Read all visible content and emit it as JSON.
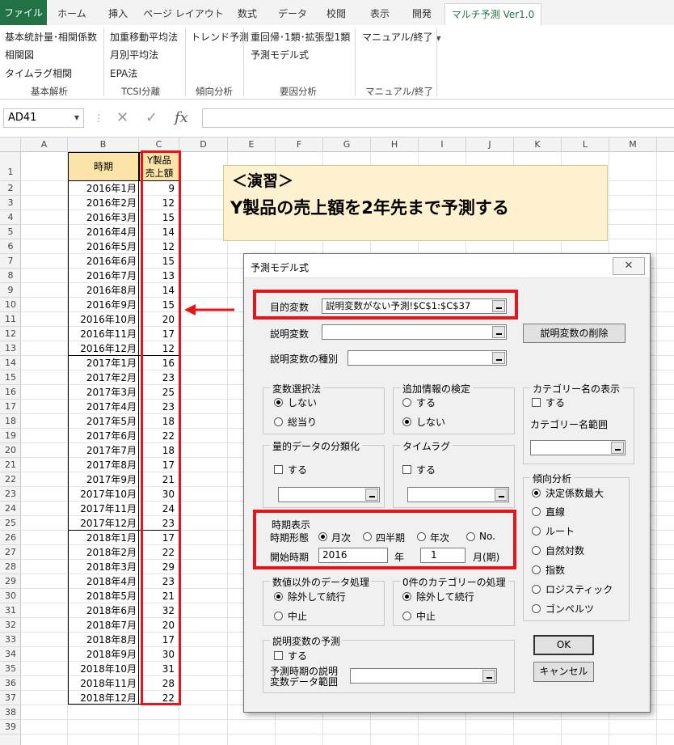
{
  "ribbon": {
    "tabs": [
      "ファイル",
      "ホーム",
      "挿入",
      "ページ レイアウト",
      "数式",
      "データ",
      "校閲",
      "表示",
      "開発",
      "マルチ予測 Ver1.0"
    ],
    "commands": {
      "basic_stats": "基本統計量･相関係数",
      "correlation_chart": "相関図",
      "timelag_corr": "タイムラグ相関",
      "weighted_ma": "加重移動平均法",
      "monthly_avg": "月別平均法",
      "epa": "EPA法",
      "trend_forecast": "トレンド予測",
      "regression": "重回帰･1類･拡張型1類",
      "forecast_model": "予測モデル式",
      "manual_exit": "マニュアル/終了"
    },
    "groups": {
      "basic": "基本解析",
      "tcsi": "TCSI分離",
      "trend": "傾向分析",
      "factor": "要因分析",
      "manual": "マニュアル/終了"
    }
  },
  "formula_bar": {
    "name_box": "AD41",
    "cancel": "✕",
    "enter": "✓",
    "fx": "fx",
    "value": ""
  },
  "columns": [
    "A",
    "B",
    "C",
    "D",
    "E",
    "F",
    "G",
    "H",
    "I",
    "J",
    "K",
    "L",
    "M"
  ],
  "rows": [
    "1",
    "2",
    "3",
    "4",
    "5",
    "6",
    "7",
    "8",
    "9",
    "10",
    "11",
    "12",
    "13",
    "14",
    "15",
    "16",
    "17",
    "18",
    "19",
    "20",
    "21",
    "22",
    "23",
    "24",
    "25",
    "26",
    "27",
    "28",
    "29",
    "30",
    "31",
    "32",
    "33",
    "34",
    "35",
    "36",
    "37",
    "38",
    "39"
  ],
  "table": {
    "header_period": "時期",
    "header_sales_1": "Y製品",
    "header_sales_2": "売上額",
    "periods": [
      "2016年1月",
      "2016年2月",
      "2016年3月",
      "2016年4月",
      "2016年5月",
      "2016年6月",
      "2016年7月",
      "2016年8月",
      "2016年9月",
      "2016年10月",
      "2016年11月",
      "2016年12月",
      "2017年1月",
      "2017年2月",
      "2017年3月",
      "2017年4月",
      "2017年5月",
      "2017年6月",
      "2017年7月",
      "2017年8月",
      "2017年9月",
      "2017年10月",
      "2017年11月",
      "2017年12月",
      "2018年1月",
      "2018年2月",
      "2018年3月",
      "2018年4月",
      "2018年5月",
      "2018年6月",
      "2018年7月",
      "2018年8月",
      "2018年9月",
      "2018年10月",
      "2018年11月",
      "2018年12月"
    ],
    "sales": [
      "9",
      "12",
      "15",
      "14",
      "12",
      "15",
      "13",
      "14",
      "15",
      "20",
      "17",
      "12",
      "16",
      "23",
      "25",
      "23",
      "18",
      "22",
      "18",
      "17",
      "21",
      "30",
      "24",
      "23",
      "17",
      "22",
      "29",
      "23",
      "21",
      "32",
      "20",
      "17",
      "30",
      "31",
      "28",
      "22"
    ]
  },
  "note": {
    "line1": "＜演習＞",
    "line2": "Y製品の売上額を2年先まで予測する"
  },
  "dialog": {
    "title": "予測モデル式",
    "close": "✕",
    "target_var_label": "目的変数",
    "target_var_value": "説明変数がない予測!$C$1:$C$37",
    "expl_var_label": "説明変数",
    "expl_var_value": "",
    "delete_expl_button": "説明変数の削除",
    "expl_type_label": "説明変数の種別",
    "expl_type_value": "",
    "var_select": {
      "caption": "変数選択法",
      "opt1": "しない",
      "opt2": "総当り"
    },
    "additional_test": {
      "caption": "追加情報の検定",
      "opt1": "する",
      "opt2": "しない"
    },
    "category_name": {
      "caption": "カテゴリー名の表示",
      "check": "する",
      "range_label": "カテゴリー名範囲",
      "range_value": ""
    },
    "quant_class": {
      "caption": "量的データの分類化",
      "check": "する",
      "value": ""
    },
    "timelag": {
      "caption": "タイムラグ",
      "check": "する",
      "value": ""
    },
    "trend": {
      "caption": "傾向分析",
      "options": [
        "決定係数最大",
        "直線",
        "ルート",
        "自然対数",
        "指数",
        "ロジスティック",
        "ゴンペルツ"
      ]
    },
    "period": {
      "caption": "時期表示",
      "form_label": "時期形態",
      "opt_monthly": "月次",
      "opt_quarter": "四半期",
      "opt_yearly": "年次",
      "opt_no": "No.",
      "start_label": "開始時期",
      "start_year": "2016",
      "year_unit": "年",
      "start_month": "1",
      "month_unit": "月(期)"
    },
    "non_numeric": {
      "caption": "数値以外のデータ処理",
      "opt1": "除外して続行",
      "opt2": "中止"
    },
    "zero_category": {
      "caption": "0件のカテゴリーの処理",
      "opt1": "除外して続行",
      "opt2": "中止"
    },
    "expl_forecast": {
      "caption": "説明変数の予測",
      "check": "する",
      "range_label_1": "予測時期の説明",
      "range_label_2": "変数データ範囲",
      "range_value": ""
    },
    "ok_button": "OK",
    "cancel_button": "キャンセル"
  },
  "colors": {
    "excel_green": "#217346",
    "highlight_red": "#e8141c",
    "header_fill": "#fce4a8",
    "note_fill": "#fdf1cf"
  }
}
